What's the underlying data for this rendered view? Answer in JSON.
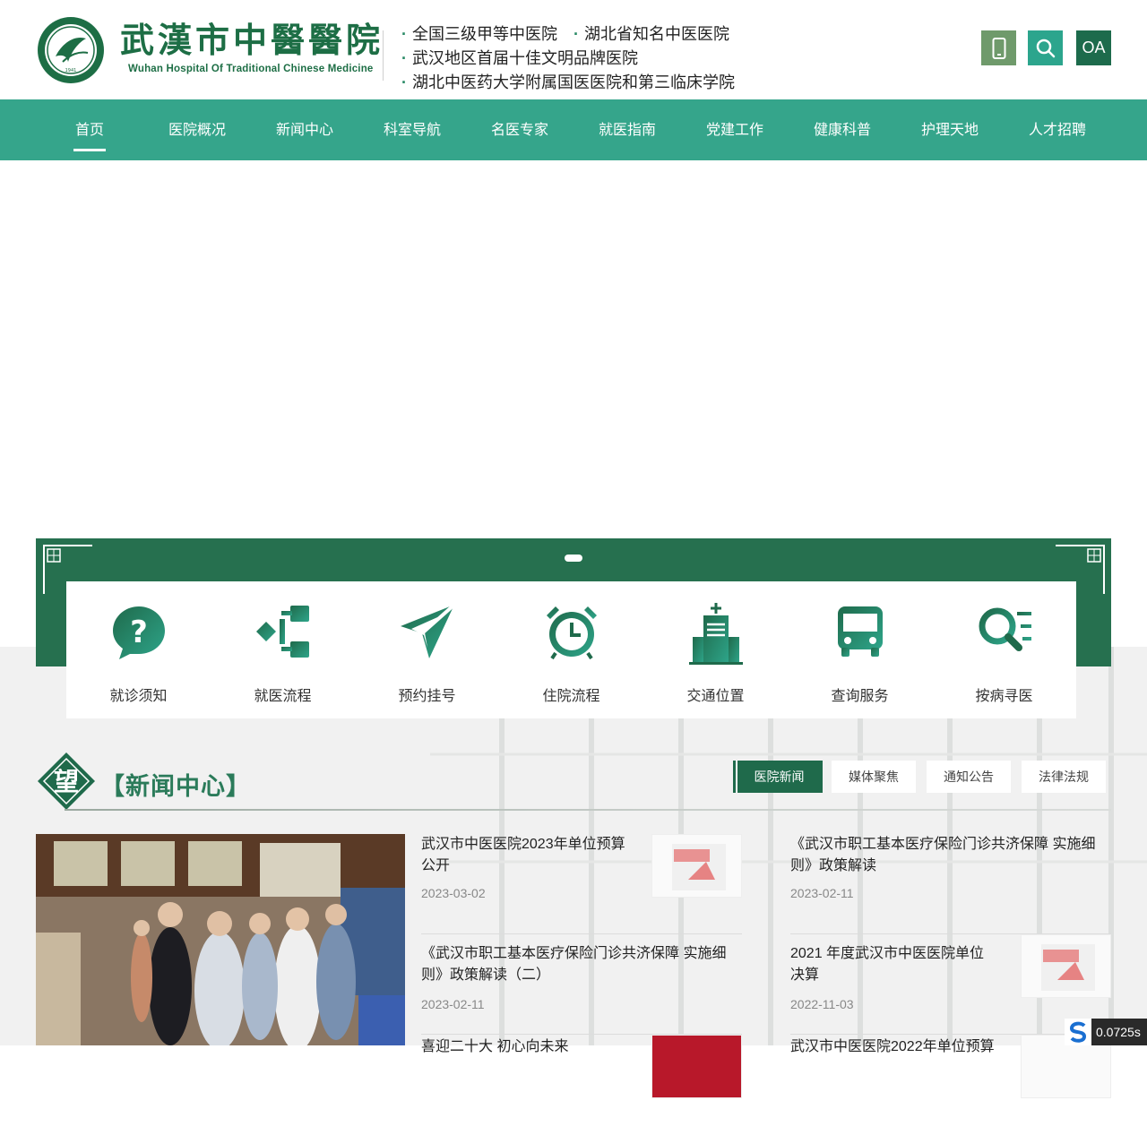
{
  "header": {
    "logo_cn": "武漢市中醫醫院",
    "logo_en": "Wuhan Hospital Of Traditional Chinese Medicine",
    "slogans": [
      "全国三级甲等中医院",
      "湖北省知名中医医院",
      "武汉地区首届十佳文明品牌医院",
      "湖北中医药大学附属国医医院和第三临床学院"
    ],
    "oa_label": "OA",
    "buttons": [
      "phone-icon",
      "search-icon"
    ]
  },
  "nav": {
    "items": [
      "首页",
      "医院概况",
      "新闻中心",
      "科室导航",
      "名医专家",
      "就医指南",
      "党建工作",
      "健康科普",
      "护理天地",
      "人才招聘"
    ],
    "active": "首页"
  },
  "quick": {
    "items": [
      {
        "label": "就诊须知",
        "icon": "question-icon"
      },
      {
        "label": "就医流程",
        "icon": "flow-icon"
      },
      {
        "label": "预约挂号",
        "icon": "paper-plane-icon"
      },
      {
        "label": "住院流程",
        "icon": "alarm-clock-icon"
      },
      {
        "label": "交通位置",
        "icon": "building-icon"
      },
      {
        "label": "查询服务",
        "icon": "bus-icon"
      },
      {
        "label": "按病寻医",
        "icon": "search-list-icon"
      }
    ]
  },
  "news": {
    "badge": "望",
    "title": "【新闻中心】",
    "tabs": [
      "医院新闻",
      "媒体聚焦",
      "通知公告",
      "法律法规"
    ],
    "active_tab": "医院新闻",
    "col1": [
      {
        "title": "武汉市中医医院2023年单位预算公开",
        "date": "2023-03-02",
        "thumb": true
      },
      {
        "title": "《武汉市职工基本医疗保险门诊共济保障 实施细则》政策解读（二）",
        "date": "2023-02-11",
        "thumb": false
      },
      {
        "title": "喜迎二十大 初心向未来",
        "date": "",
        "thumb": true
      }
    ],
    "col2": [
      {
        "title": "《武汉市职工基本医疗保险门诊共济保障 实施细则》政策解读",
        "date": "2023-02-11",
        "thumb": false
      },
      {
        "title": "2021 年度武汉市中医医院单位决算",
        "date": "2022-11-03",
        "thumb": true
      },
      {
        "title": "武汉市中医医院2022年单位预算",
        "date": "",
        "thumb": true
      }
    ]
  },
  "timer": "0.0725s",
  "colors": {
    "primary_green": "#35a58b",
    "dark_green": "#26704f",
    "logo_green": "#1d6e45"
  }
}
